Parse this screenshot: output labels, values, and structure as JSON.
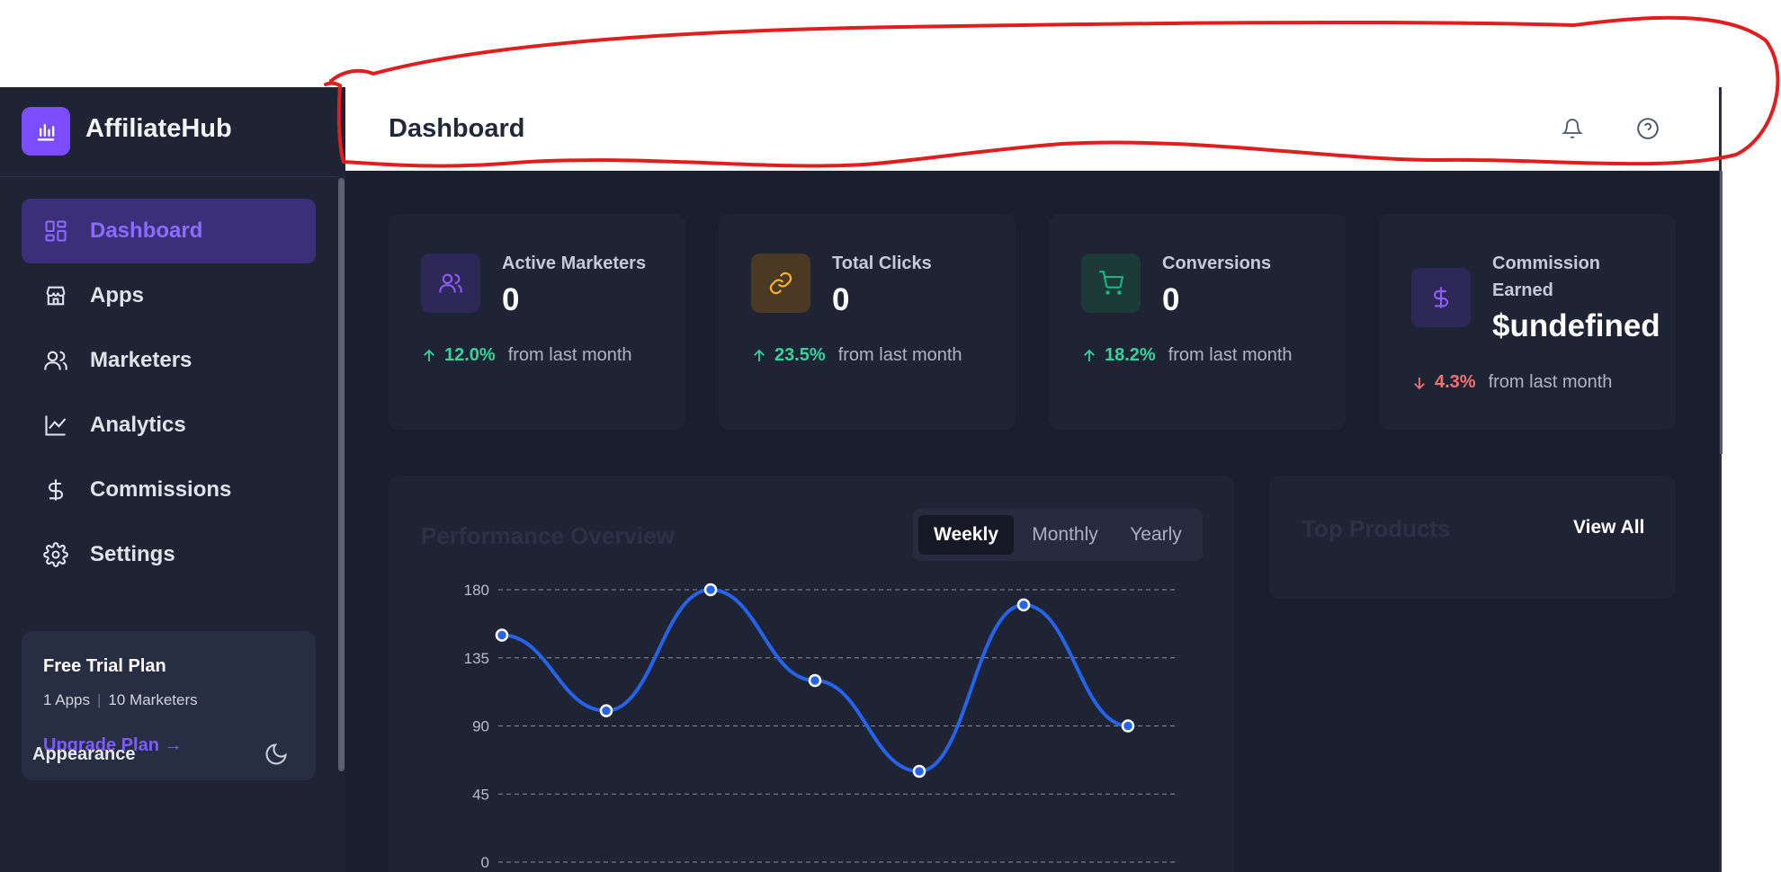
{
  "sidebar": {
    "brand": "AffiliateHub",
    "items": [
      {
        "label": "Dashboard",
        "icon": "grid-icon",
        "active": true
      },
      {
        "label": "Apps",
        "icon": "store-icon"
      },
      {
        "label": "Marketers",
        "icon": "users-icon"
      },
      {
        "label": "Analytics",
        "icon": "line-chart-icon"
      },
      {
        "label": "Commissions",
        "icon": "dollar-icon"
      },
      {
        "label": "Settings",
        "icon": "gear-icon"
      }
    ],
    "plan": {
      "title": "Free Trial Plan",
      "apps": "1 Apps",
      "separator": "|",
      "marketers": "10 Marketers",
      "upgrade": "Upgrade Plan →"
    },
    "appearance": "Appearance"
  },
  "header": {
    "title": "Dashboard",
    "icons": [
      "bell-icon",
      "help-icon"
    ]
  },
  "stats": [
    {
      "label": "Active Marketers",
      "value": "0",
      "trend": "12.0%",
      "direction": "up",
      "suffix": "from last month",
      "icon": "users-icon",
      "color": "#8b5cf6"
    },
    {
      "label": "Total Clicks",
      "value": "0",
      "trend": "23.5%",
      "direction": "up",
      "suffix": "from last month",
      "icon": "link-icon",
      "color": "#f59e0b"
    },
    {
      "label": "Conversions",
      "value": "0",
      "trend": "18.2%",
      "direction": "up",
      "suffix": "from last month",
      "icon": "cart-icon",
      "color": "#10b981"
    },
    {
      "label": "Commission Earned",
      "value": "$undefined",
      "trend": "4.3%",
      "direction": "down",
      "suffix": "from last month",
      "icon": "dollar-icon",
      "color": "#8b5cf6"
    }
  ],
  "performance": {
    "title": "Performance Overview",
    "tabs": [
      "Weekly",
      "Monthly",
      "Yearly"
    ],
    "active_tab": "Weekly"
  },
  "top_products": {
    "title": "Top Products",
    "view_all": "View All"
  },
  "chart_data": {
    "type": "line",
    "title": "Performance Overview",
    "yticks": [
      0,
      45,
      90,
      135,
      180
    ],
    "ylim": [
      0,
      180
    ],
    "series": [
      {
        "values": [
          150,
          100,
          180,
          120,
          60,
          170,
          90
        ]
      }
    ],
    "grid": true
  },
  "colors": {
    "accent": "#7c4dff",
    "line": "#2563eb",
    "up": "#34d399",
    "down": "#f87171",
    "annotation": "#e11d1d"
  }
}
